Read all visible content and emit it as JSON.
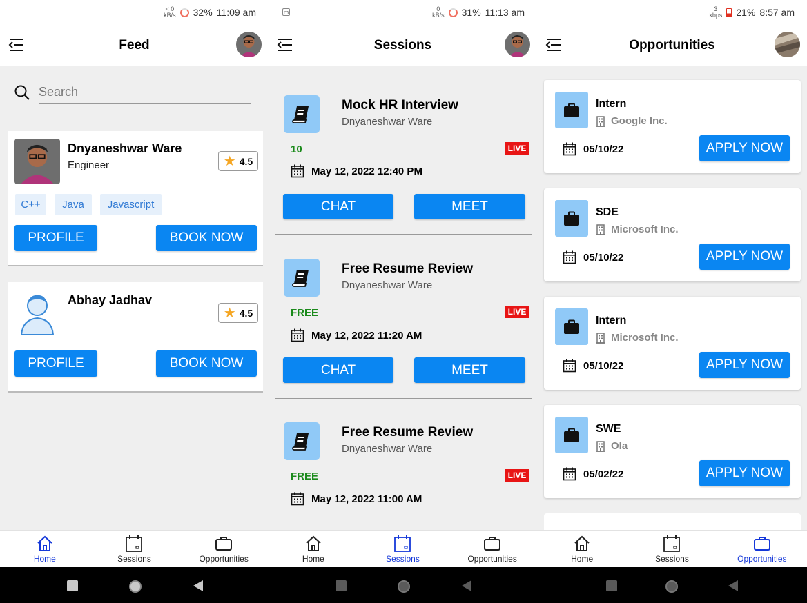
{
  "feed_screen": {
    "status": {
      "net_top": "< 0",
      "net_unit": "kB/s",
      "battery": "32%",
      "time": "11:09 am"
    },
    "title": "Feed",
    "search": {
      "placeholder": "Search"
    },
    "mentors": [
      {
        "name": "Dnyaneshwar Ware",
        "role": "Engineer",
        "rating": "4.5",
        "tags": [
          "C++",
          "Java",
          "Javascript"
        ],
        "profile_label": "PROFILE",
        "book_label": "BOOK NOW"
      },
      {
        "name": "Abhay Jadhav",
        "role": "",
        "rating": "4.5",
        "tags": [],
        "profile_label": "PROFILE",
        "book_label": "BOOK NOW"
      }
    ],
    "nav": [
      "Home",
      "Sessions",
      "Opportunities"
    ],
    "active_nav": "Home"
  },
  "sessions_screen": {
    "status": {
      "notif_icon": "m",
      "net_top": "0",
      "net_unit": "kB/s",
      "battery": "31%",
      "time": "11:13 am"
    },
    "title": "Sessions",
    "sessions": [
      {
        "title": "Mock HR Interview",
        "host": "Dnyaneshwar Ware",
        "price": "10",
        "live": "LIVE",
        "date": "May 12, 2022 12:40 PM",
        "chat_label": "CHAT",
        "meet_label": "MEET"
      },
      {
        "title": "Free Resume Review",
        "host": "Dnyaneshwar Ware",
        "price": "FREE",
        "live": "LIVE",
        "date": "May 12, 2022 11:20 AM",
        "chat_label": "CHAT",
        "meet_label": "MEET"
      },
      {
        "title": "Free Resume Review",
        "host": "Dnyaneshwar Ware",
        "price": "FREE",
        "live": "LIVE",
        "date": "May 12, 2022 11:00 AM"
      }
    ],
    "nav": [
      "Home",
      "Sessions",
      "Opportunities"
    ],
    "active_nav": "Sessions"
  },
  "opportunities_screen": {
    "status": {
      "net_top": "3",
      "net_unit": "kbps",
      "battery": "21%",
      "time": "8:57 am"
    },
    "title": "Opportunities",
    "opportunities": [
      {
        "role": "Intern",
        "company": "Google Inc.",
        "date": "05/10/22",
        "apply_label": "APPLY NOW"
      },
      {
        "role": "SDE",
        "company": "Microsoft Inc.",
        "date": "05/10/22",
        "apply_label": "APPLY NOW"
      },
      {
        "role": "Intern",
        "company": "Microsoft Inc.",
        "date": "05/10/22",
        "apply_label": "APPLY NOW"
      },
      {
        "role": "SWE",
        "company": "Ola",
        "date": "05/02/22",
        "apply_label": "APPLY NOW"
      }
    ],
    "nav": [
      "Home",
      "Sessions",
      "Opportunities"
    ],
    "active_nav": "Opportunities"
  },
  "icons": {
    "menu": "menu-collapse-icon",
    "search": "search-icon",
    "star": "star-icon",
    "book": "book-icon",
    "calendar": "calendar-icon",
    "briefcase": "briefcase-icon",
    "building": "building-icon",
    "home": "home-icon"
  },
  "colors": {
    "primary": "#0a86f2",
    "tile": "#90c9f7",
    "active_nav": "#1538d9",
    "live": "#e81515",
    "price": "#1b8a1b"
  }
}
